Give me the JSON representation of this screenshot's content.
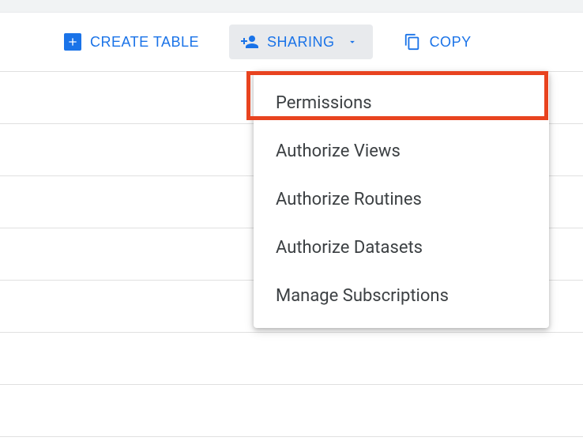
{
  "toolbar": {
    "create_table": "CREATE TABLE",
    "sharing": "SHARING",
    "copy": "COPY"
  },
  "menu": {
    "items": [
      "Permissions",
      "Authorize Views",
      "Authorize Routines",
      "Authorize Datasets",
      "Manage Subscriptions"
    ]
  }
}
